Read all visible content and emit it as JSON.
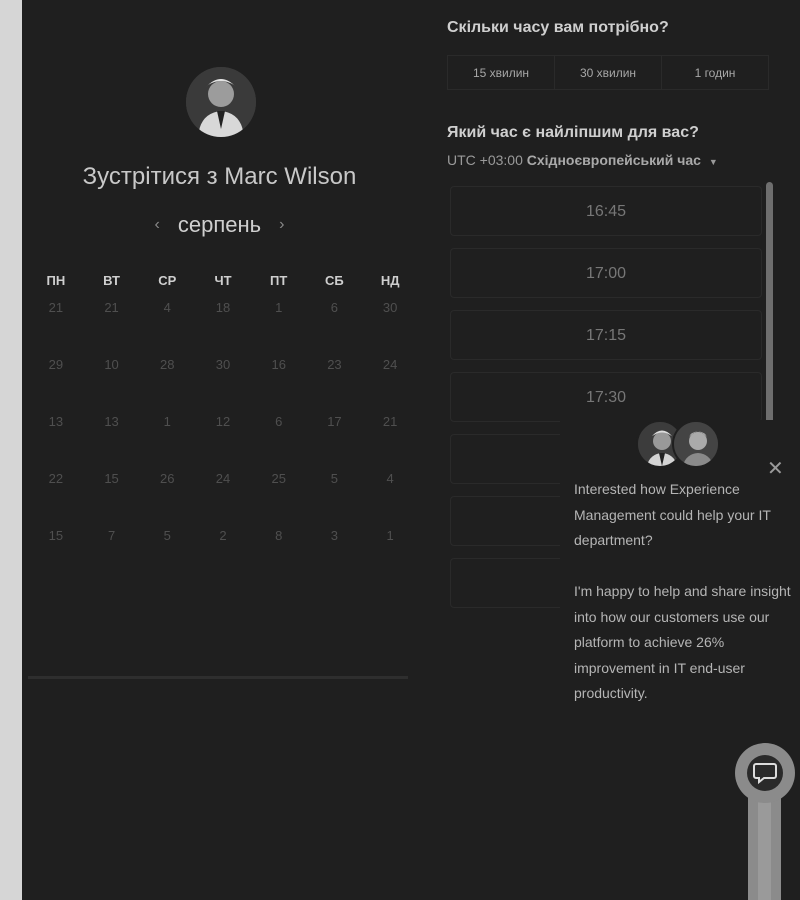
{
  "meeting": {
    "title": "Зустрітися з Marc Wilson",
    "month": "серпень"
  },
  "calendar": {
    "weekdays": [
      "ПН",
      "ВТ",
      "СР",
      "ЧТ",
      "ПТ",
      "СБ",
      "НД"
    ],
    "weeks": [
      [
        "21",
        "21",
        "4",
        "18",
        "1",
        "6",
        "30"
      ],
      [
        "29",
        "10",
        "28",
        "30",
        "16",
        "23",
        "24"
      ],
      [
        "13",
        "13",
        "1",
        "12",
        "6",
        "17",
        "21"
      ],
      [
        "22",
        "15",
        "26",
        "24",
        "25",
        "5",
        "4"
      ],
      [
        "15",
        "7",
        "5",
        "2",
        "8",
        "3",
        "1"
      ]
    ]
  },
  "duration": {
    "question": "Скільки часу вам потрібно?",
    "options": [
      "15 хвилин",
      "30 хвилин",
      "1 годин"
    ]
  },
  "time": {
    "question": "Який час є найліпшим для вас?",
    "tz_prefix": "UTC +03:00",
    "tz_name": "Східноєвропейський час",
    "slots": [
      "16:45",
      "17:00",
      "17:15",
      "17:30",
      "",
      "",
      ""
    ]
  },
  "chat": {
    "paragraph1": "Interested how Experience Management could help your IT department?",
    "paragraph2": "I'm happy to help and share insight into how our customers use our platform to achieve 26% improvement in IT end-user productivity."
  },
  "icons": {
    "prev": "chevron-left-icon",
    "next": "chevron-right-icon",
    "close": "close-icon",
    "chat": "chat-bubble-icon"
  }
}
